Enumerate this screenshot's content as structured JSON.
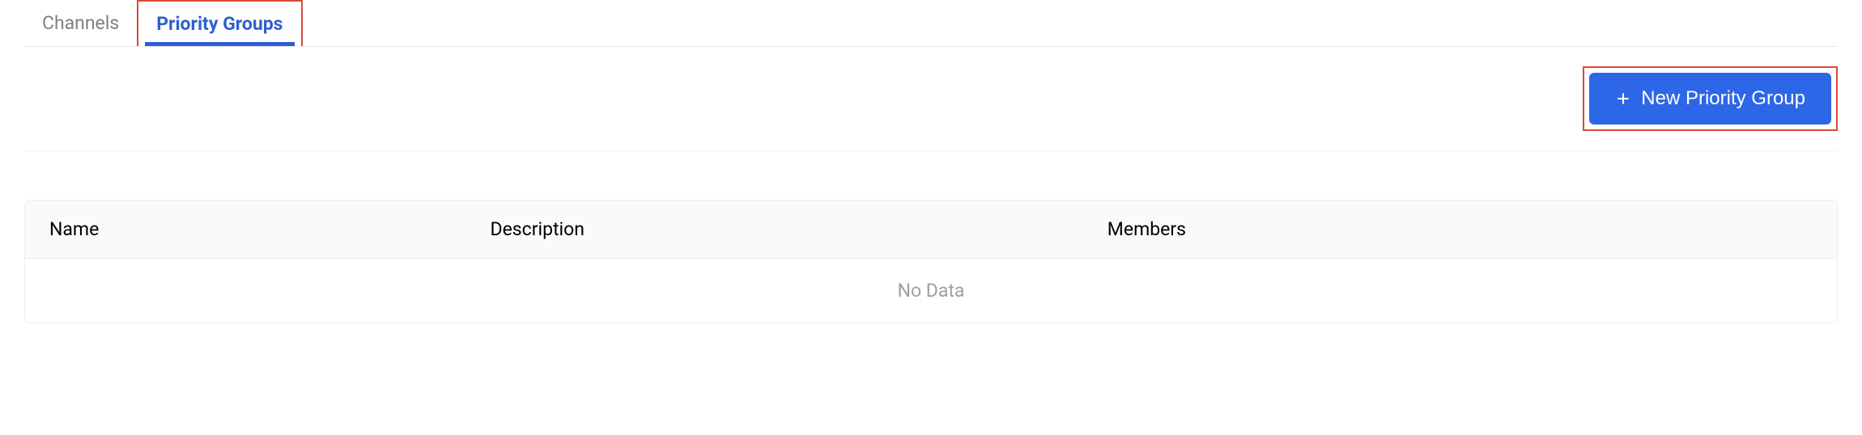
{
  "tabs": {
    "channels": {
      "label": "Channels"
    },
    "priority_groups": {
      "label": "Priority Groups"
    }
  },
  "toolbar": {
    "new_group_label": "New Priority Group"
  },
  "table": {
    "columns": {
      "name": "Name",
      "description": "Description",
      "members": "Members"
    },
    "empty_text": "No Data"
  }
}
